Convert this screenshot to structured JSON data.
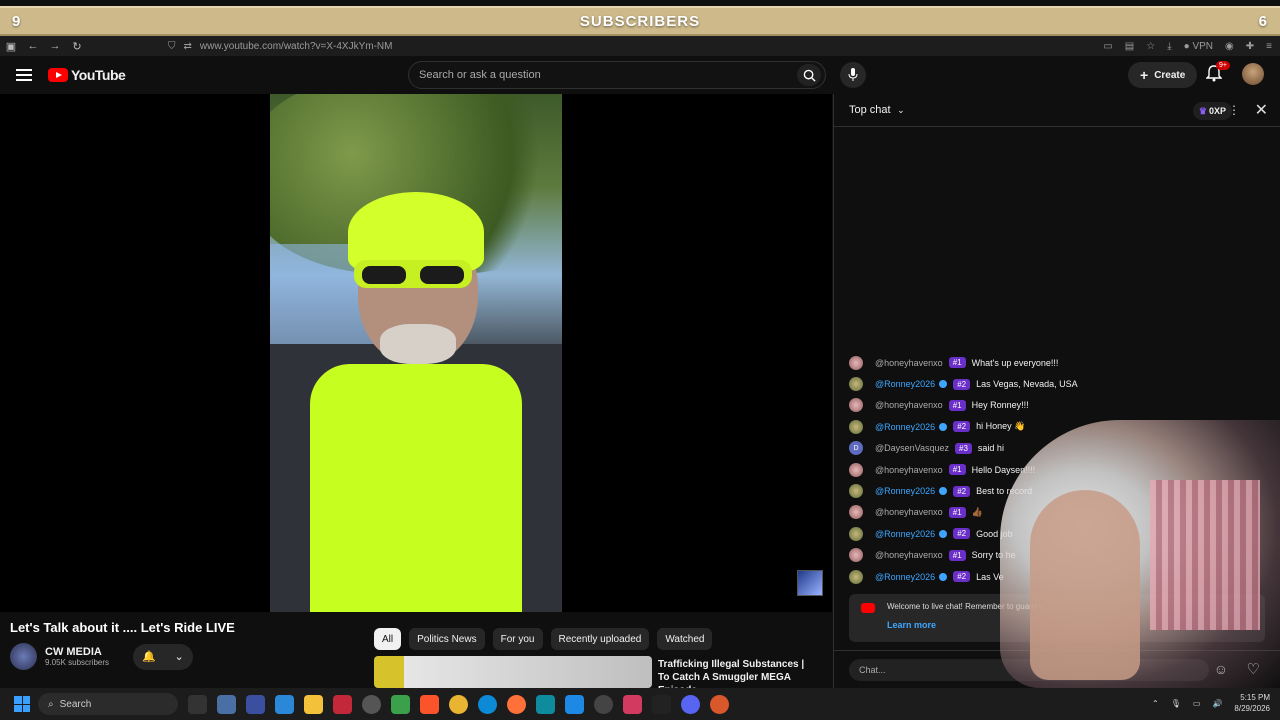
{
  "overlay": {
    "left_count": "9",
    "title": "SUBSCRIBERS",
    "right_count": "6"
  },
  "browser": {
    "url": "www.youtube.com/watch?v=X-4XJkYm-NM",
    "vpn_label": "VPN"
  },
  "youtube": {
    "logo_text": "YouTube",
    "search_placeholder": "Search or ask a question",
    "create_label": "Create",
    "notif_badge": "9+"
  },
  "video": {
    "title": "Let's Talk about it .... Let's Ride LIVE",
    "channel_name": "CW MEDIA",
    "channel_subs": "9.05K subscribers"
  },
  "chips": [
    "All",
    "Politics News",
    "For you",
    "Recently uploaded",
    "Watched"
  ],
  "recommendation": {
    "title": "Trafficking Illegal Substances | To Catch A Smuggler MEGA Episode"
  },
  "chat": {
    "mode": "Top chat",
    "xp": "0XP",
    "messages": [
      {
        "user": "@honeyhavenxo",
        "rank": "#1",
        "text": "What's up everyone!!!",
        "avatar": "honey",
        "owner": false
      },
      {
        "user": "@Ronney2026",
        "rank": "#2",
        "text": "Las Vegas, Nevada, USA",
        "avatar": "ronney",
        "owner": true
      },
      {
        "user": "@honeyhavenxo",
        "rank": "#1",
        "text": "Hey Ronney!!!",
        "avatar": "honey",
        "owner": false
      },
      {
        "user": "@Ronney2026",
        "rank": "#2",
        "text": "hi Honey 👋",
        "avatar": "ronney",
        "owner": true
      },
      {
        "user": "@DaysenVasquez",
        "rank": "#3",
        "text": "said hi",
        "avatar": "daysen",
        "owner": false
      },
      {
        "user": "@honeyhavenxo",
        "rank": "#1",
        "text": "Hello Daysen!!!!",
        "avatar": "honey",
        "owner": false
      },
      {
        "user": "@Ronney2026",
        "rank": "#2",
        "text": "Best to record",
        "avatar": "ronney",
        "owner": true
      },
      {
        "user": "@honeyhavenxo",
        "rank": "#1",
        "text": "👍🏾",
        "avatar": "honey",
        "owner": false
      },
      {
        "user": "@Ronney2026",
        "rank": "#2",
        "text": "Good job",
        "avatar": "ronney",
        "owner": true
      },
      {
        "user": "@honeyhavenxo",
        "rank": "#1",
        "text": "Sorry to he",
        "avatar": "honey",
        "owner": false
      },
      {
        "user": "@Ronney2026",
        "rank": "#2",
        "text": "Las Ve",
        "avatar": "ronney",
        "owner": true
      }
    ],
    "welcome_text": "Welcome to live chat! Remember to guard y",
    "learn_more": "Learn more",
    "input_placeholder": "Chat..."
  },
  "taskbar": {
    "search_label": "Search",
    "time": "5:15 PM",
    "date": "8/29/2026"
  }
}
